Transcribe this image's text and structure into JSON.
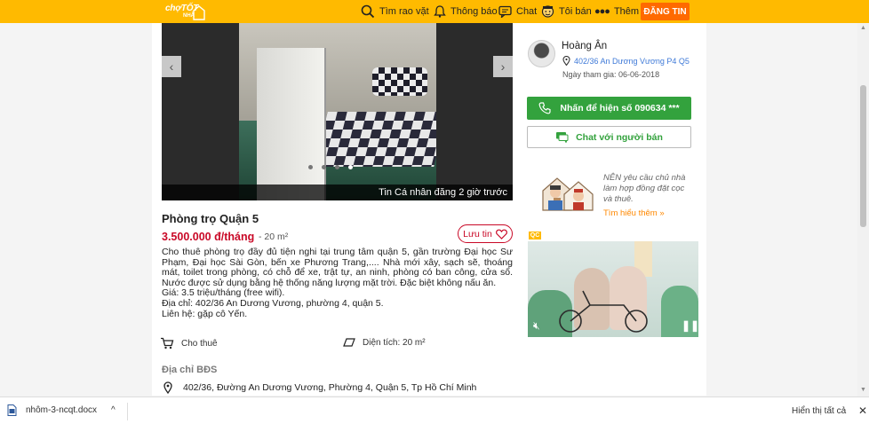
{
  "header": {
    "logo": {
      "line1": "chợTỐT",
      "line2": "NHÀ"
    },
    "search_label": "Tìm rao vặt",
    "notify_label": "Thông báo",
    "chat_label": "Chat",
    "sell_label": "Tôi bán",
    "more_label": "Thêm",
    "post_label": "ĐĂNG TIN",
    "accent": "#ffba00",
    "post_color": "#ff6a00"
  },
  "gallery": {
    "caption": "Tin Cá nhân đăng 2 giờ trước",
    "prev_label": "‹",
    "next_label": "›",
    "dot_count": 4,
    "active_dot": 3
  },
  "listing": {
    "title": "Phòng trọ Quận 5",
    "price": "3.500.000 đ/tháng",
    "area_short": "- 20 m²",
    "save_label": "Lưu tin",
    "description": "Cho thuê phòng trọ đầy đủ tiện nghi tại trung tâm quận 5, gần trường Đại học Sư Phạm, Đại học Sài Gòn, bến xe Phương Trang,.... Nhà mới xây, sạch sẽ, thoáng mát, toilet trong phòng, có chỗ để xe, trật tự, an ninh, phòng có ban công, cửa sổ. Nước được sử dụng bằng hệ thống năng lượng mặt trời. Đặc biệt không nấu ăn.",
    "price_line": "Giá: 3.5 triệu/tháng (free wifi).",
    "address_line": "Địa chỉ: 402/36 An Dương Vương, phường 4, quận 5.",
    "contact_line": "Liên hệ: gặp cô Yến.",
    "type_label": "Cho thuê",
    "area_label": "Diện tích: 20 m²",
    "address_heading": "Địa chỉ BĐS",
    "full_address": "402/36, Đường An Dương Vương, Phường 4, Quận 5, Tp Hồ Chí Minh",
    "price_color": "#c90927"
  },
  "seller": {
    "name": "Hoàng Ân",
    "address": "402/36 An Dương Vương P4 Q5",
    "joined": "Ngày tham gia: 06-06-2018",
    "call_label": "Nhấn để hiện số 090634 ***",
    "chat_label": "Chat với người bán",
    "call_color": "#33a23d"
  },
  "tip": {
    "text": "NÊN yêu cầu chủ nhà làm hợp đồng đặt cọc và thuê.",
    "link": "Tìm hiểu thêm »"
  },
  "ad": {
    "badge": "QC"
  },
  "downloads": {
    "file_name": "nhôm-3-ncqt.docx",
    "show_all": "Hiển thị tất cả",
    "close": "✕",
    "chevron": "^"
  }
}
